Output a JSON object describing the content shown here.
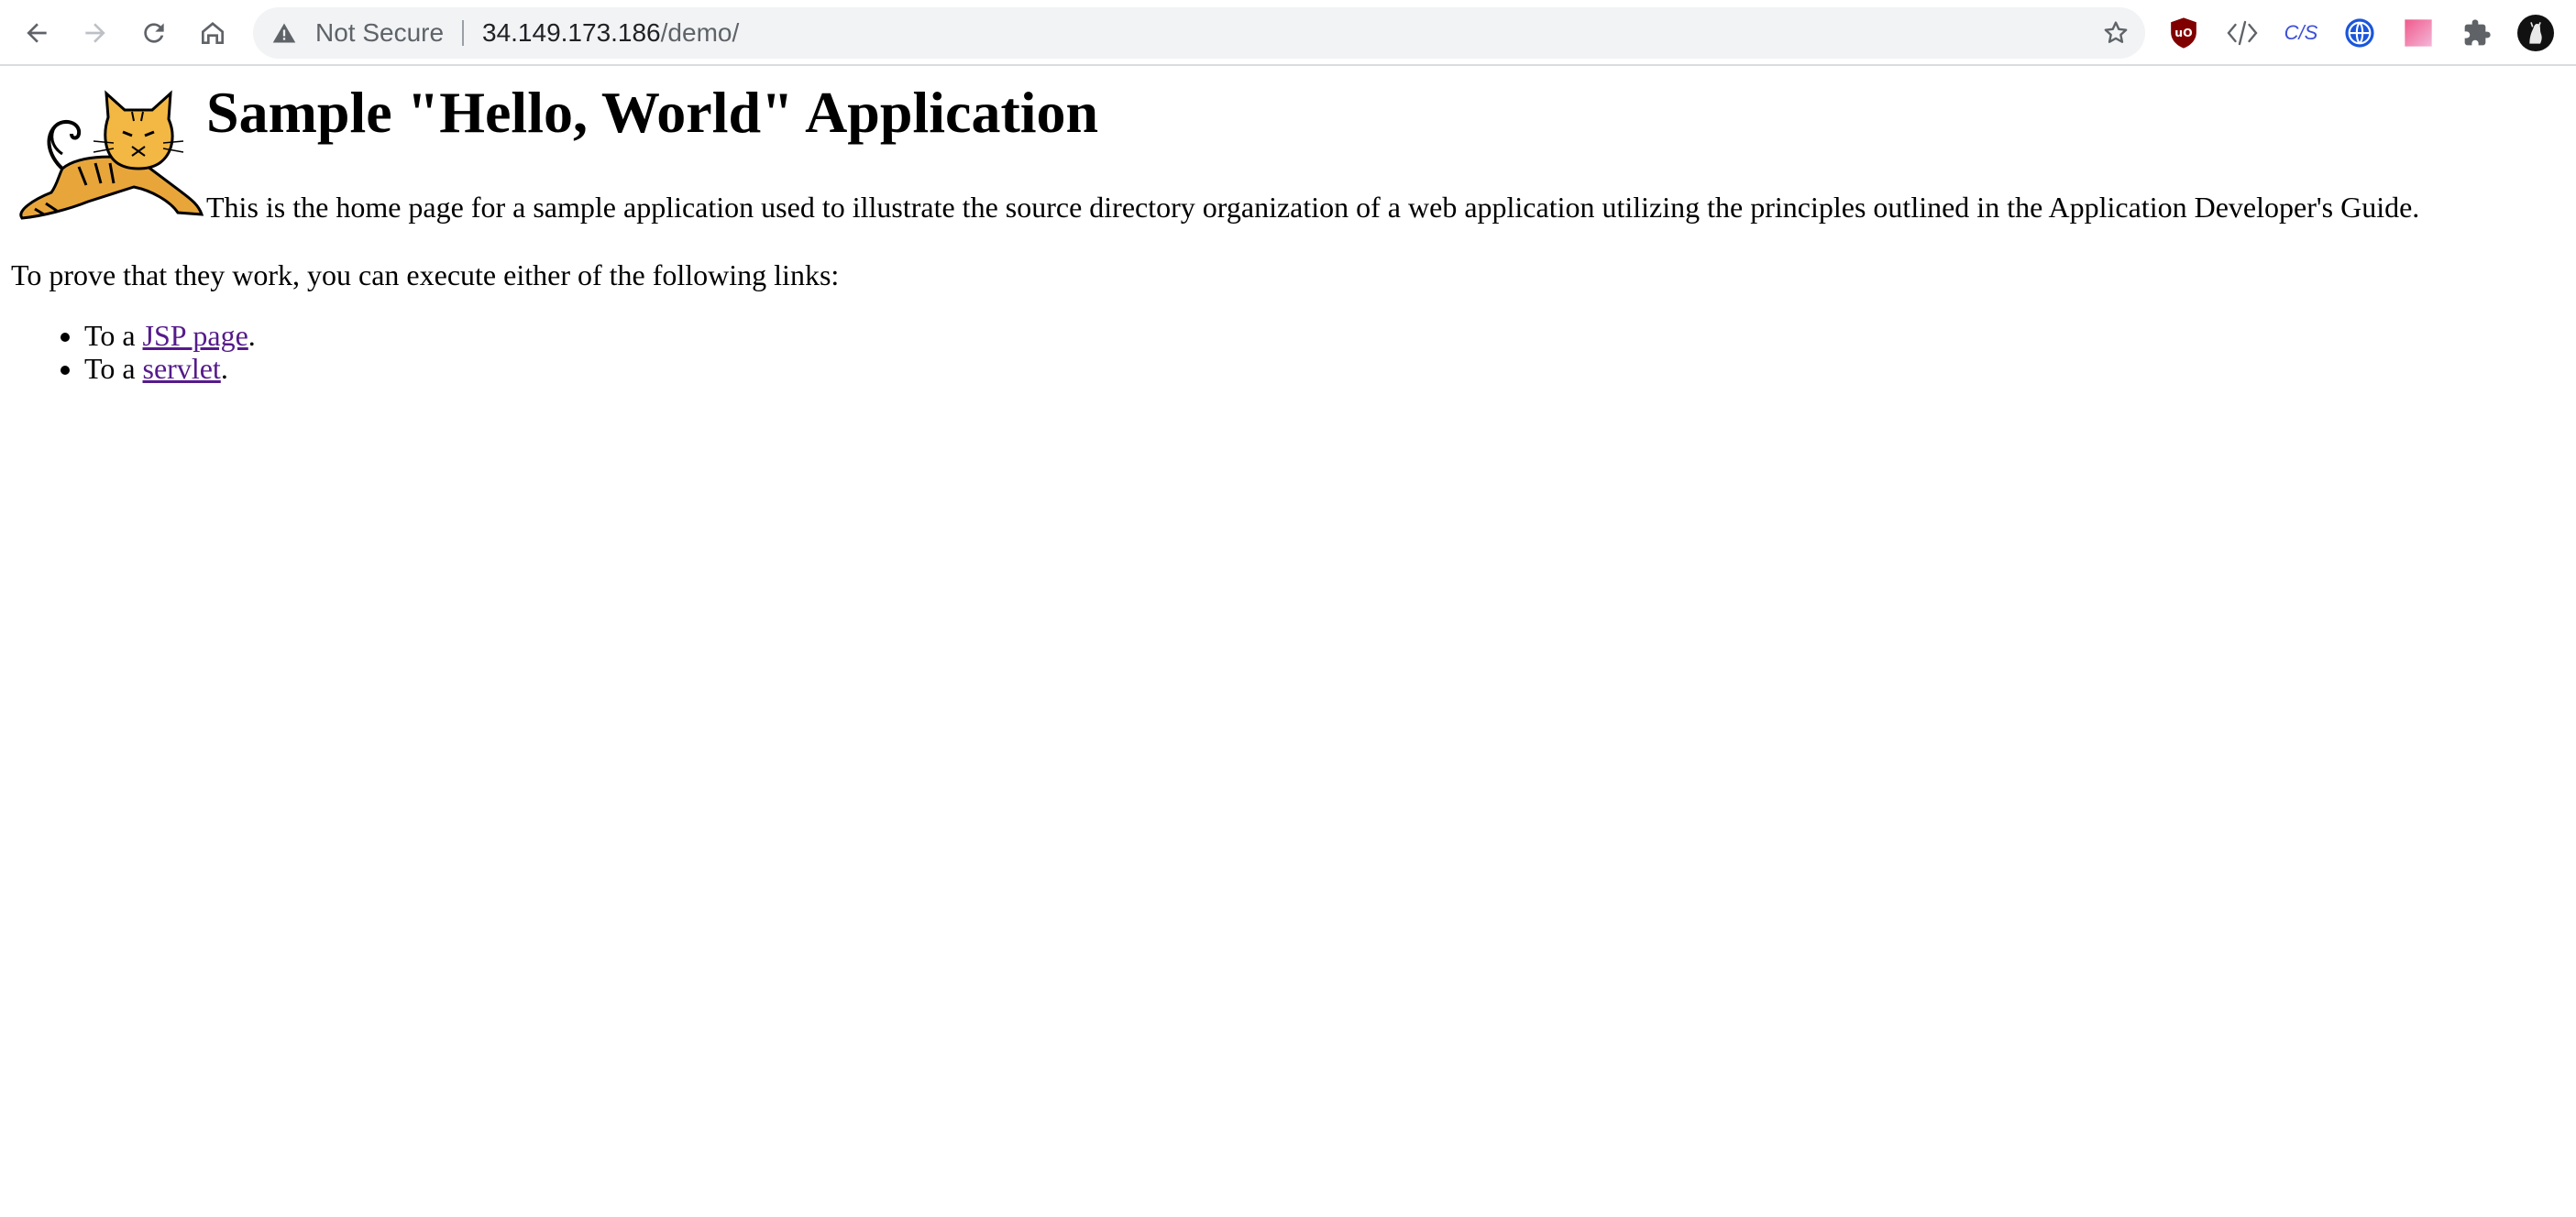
{
  "browser": {
    "security_label": "Not Secure",
    "url_host": "34.149.173.186",
    "url_path": "/demo/"
  },
  "extensions": [
    {
      "icon": "ublock-icon"
    },
    {
      "icon": "code-brackets-icon"
    },
    {
      "icon": "css-js-icon",
      "label": "C/S"
    },
    {
      "icon": "globe-icon"
    },
    {
      "icon": "gradient-square-icon"
    },
    {
      "icon": "puzzle-icon"
    },
    {
      "icon": "profile-avatar-icon"
    }
  ],
  "page": {
    "title": "Sample \"Hello, World\" Application",
    "intro": "This is the home page for a sample application used to illustrate the source directory organization of a web application utilizing the principles outlined in the Application Developer's Guide.",
    "prove_text": "To prove that they work, you can execute either of the following links:",
    "links": [
      {
        "prefix": "To a ",
        "link_text": "JSP page",
        "suffix": "."
      },
      {
        "prefix": "To a ",
        "link_text": "servlet",
        "suffix": "."
      }
    ]
  },
  "colors": {
    "visited_link": "#551a8b",
    "ublock_red": "#800000",
    "omnibox_bg": "#f1f3f4"
  }
}
